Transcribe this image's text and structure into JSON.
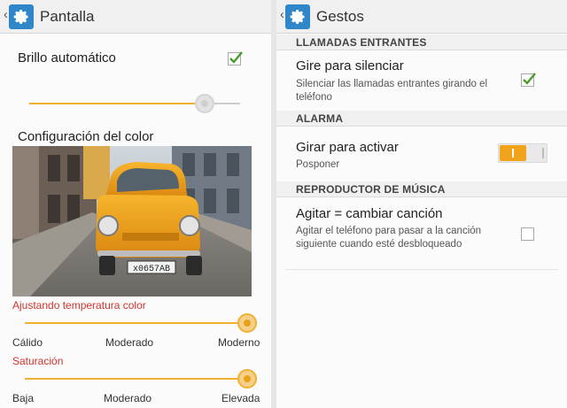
{
  "left": {
    "title": "Pantalla",
    "auto_brightness": {
      "label": "Brillo automático",
      "checked": true
    },
    "brightness": {
      "level": 0.83
    },
    "color_config": {
      "label": "Configuración del color"
    },
    "temperature": {
      "label": "Ajustando temperatura color",
      "level": 1.0,
      "ticks": [
        "Cálido",
        "Moderado",
        "Moderno"
      ]
    },
    "saturation": {
      "label": "Saturación",
      "level": 1.0,
      "ticks": [
        "Baja",
        "Moderado",
        "Elevada"
      ]
    },
    "photo": {
      "plate": "х0657АВ"
    }
  },
  "right": {
    "title": "Gestos",
    "sections": [
      {
        "header": "LLAMADAS ENTRANTES"
      },
      {
        "header": "ALARMA"
      },
      {
        "header": "REPRODUCTOR DE MÚSICA"
      }
    ],
    "items": [
      {
        "title": "Gire para silenciar",
        "subtitle": "Silenciar las llamadas entrantes girando el teléfono",
        "checked": true
      },
      {
        "title": "Girar para activar",
        "subtitle": "Posponer",
        "enabled": true
      },
      {
        "title": "Agitar = cambiar canción",
        "subtitle": "Agitar el teléfono para pasar a la canción siguiente cuando esté desbloqueado",
        "checked": false
      }
    ]
  },
  "colors": {
    "accent": "#f0b130",
    "check": "#4a9a2c",
    "red_label": "#d0342c",
    "header_icon": "#2f87c9"
  },
  "icons": [
    "back-chevron-icon",
    "settings-gear-icon",
    "checkmark-icon"
  ]
}
